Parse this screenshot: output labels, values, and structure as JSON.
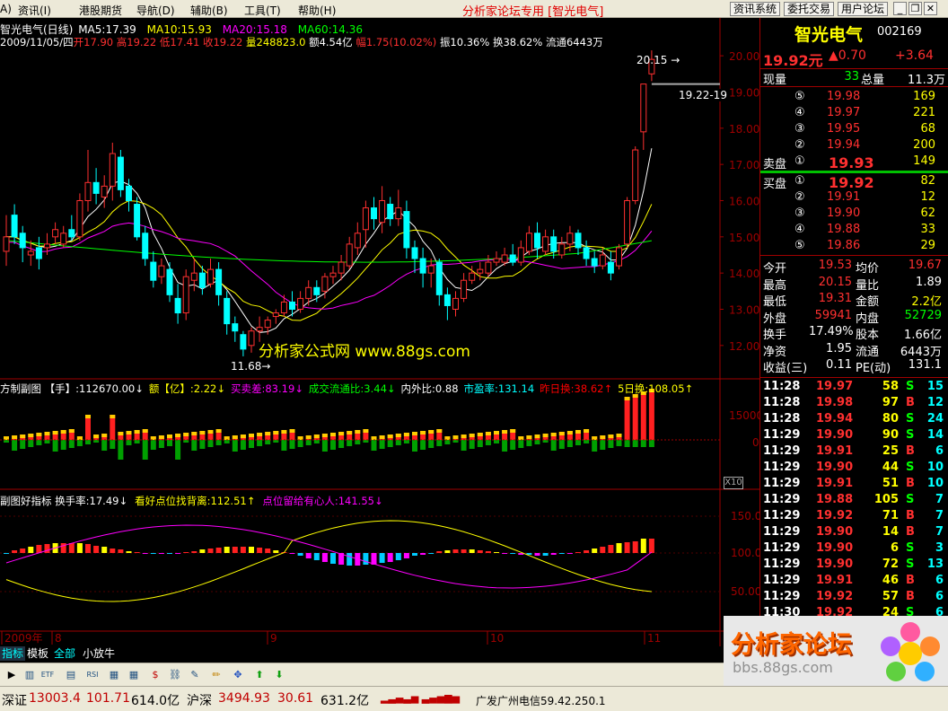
{
  "menubar": {
    "items": [
      "A)",
      "资讯(I)",
      "港股期货",
      "导航(D)",
      "辅助(B)",
      "工具(T)",
      "帮助(H)"
    ],
    "title": "分析家论坛专用 [智光电气]",
    "buttons": [
      "资讯系统",
      "委托交易",
      "用户论坛"
    ]
  },
  "chart_header": {
    "line1_title": "智光电气(日线)",
    "ma5": "MA5:17.39",
    "ma10": "MA10:15.93",
    "ma20": "MA20:15.18",
    "ma60": "MA60:14.36",
    "line2": {
      "date": "2009/11/05/四",
      "open": "开17.90",
      "high": "高19.22",
      "low": "低17.41",
      "close": "收19.22",
      "volume": "量248823.0",
      "amount": "额4.54亿",
      "change": "幅1.75(10.02%)",
      "amplitude": "振10.36%",
      "turnover": "换38.62%",
      "float": "流通6443万"
    }
  },
  "price_axis": [
    "20.00",
    "19.00",
    "18.00",
    "17.00",
    "16.00",
    "15.00",
    "14.00",
    "13.00",
    "12.00"
  ],
  "annotations": {
    "high_label": "20.15",
    "low_label": "11.68",
    "last_price_label": "19.22-19",
    "watermark": "分析家公式网 www.88gs.com"
  },
  "volume_panel": {
    "header": "方制副图 【手】:112670.00↓ 额【亿】:2.22↓ 买卖差:83.19↓ 成交流通比:3.44↓ 内外比:0.88 市盈率:131.14 昨日换:38.62↑ 5日换:108.05↑",
    "parts": [
      {
        "t": "方制副图 【手】:112670.00↓",
        "c": "#ffffff"
      },
      {
        "t": "额【亿】:2.22↓",
        "c": "#ffff00"
      },
      {
        "t": "买卖差:83.19↓",
        "c": "#ff00ff"
      },
      {
        "t": "成交流通比:3.44↓",
        "c": "#00ff00"
      },
      {
        "t": "内外比:0.88",
        "c": "#ffffff"
      },
      {
        "t": "市盈率:131.14",
        "c": "#00ffff"
      },
      {
        "t": "昨日换:38.62↑",
        "c": "#ff0000"
      },
      {
        "t": "5日换:108.05↑",
        "c": "#ffff00"
      }
    ],
    "axis": [
      "15000",
      "0"
    ],
    "scale_label": "X10"
  },
  "indicator_panel": {
    "parts": [
      {
        "t": "副图好指标 换手率:17.49↓",
        "c": "#ffffff"
      },
      {
        "t": "看好点位找背离:112.51↑",
        "c": "#ffff00"
      },
      {
        "t": "点位留给有心人:141.55↓",
        "c": "#ff00ff"
      }
    ],
    "axis": [
      "150.0",
      "100.0",
      "50.00"
    ]
  },
  "date_axis": [
    "2009年",
    "8",
    "9",
    "10",
    "11"
  ],
  "bottom_tabs": [
    "指标",
    "模板",
    "全部",
    "小放牛"
  ],
  "quote": {
    "name": "智光电气",
    "code": "002169",
    "price": "19.92元",
    "change": "▲0.70",
    "change_pct": "+3.64",
    "current_vol_label": "现量",
    "current_vol": "33",
    "total_vol_label": "总量",
    "total_vol": "11.3万",
    "sell_label": "卖盘",
    "buy_label": "买盘",
    "asks": [
      {
        "level": "⑤",
        "price": "19.98",
        "vol": "169"
      },
      {
        "level": "④",
        "price": "19.97",
        "vol": "221"
      },
      {
        "level": "③",
        "price": "19.95",
        "vol": "68"
      },
      {
        "level": "②",
        "price": "19.94",
        "vol": "200"
      },
      {
        "level": "①",
        "price": "19.93",
        "vol": "149"
      }
    ],
    "bids": [
      {
        "level": "①",
        "price": "19.92",
        "vol": "82"
      },
      {
        "level": "②",
        "price": "19.91",
        "vol": "12"
      },
      {
        "level": "③",
        "price": "19.90",
        "vol": "62"
      },
      {
        "level": "④",
        "price": "19.88",
        "vol": "33"
      },
      {
        "level": "⑤",
        "price": "19.86",
        "vol": "29"
      }
    ],
    "stats": [
      {
        "l1": "今开",
        "v1": "19.53",
        "c1": "#ff3030",
        "l2": "均价",
        "v2": "19.67",
        "c2": "#ff3030"
      },
      {
        "l1": "最高",
        "v1": "20.15",
        "c1": "#ff3030",
        "l2": "量比",
        "v2": "1.89",
        "c2": "#ffffff"
      },
      {
        "l1": "最低",
        "v1": "19.31",
        "c1": "#ff3030",
        "l2": "金额",
        "v2": "2.2亿",
        "c2": "#ffff00"
      },
      {
        "l1": "外盘",
        "v1": "59941",
        "c1": "#ff3030",
        "l2": "内盘",
        "v2": "52729",
        "c2": "#00ff00"
      },
      {
        "l1": "换手",
        "v1": "17.49%",
        "c1": "#ffffff",
        "l2": "股本",
        "v2": "1.66亿",
        "c2": "#ffffff"
      },
      {
        "l1": "净资",
        "v1": "1.95",
        "c1": "#ffffff",
        "l2": "流通",
        "v2": "6443万",
        "c2": "#ffffff"
      },
      {
        "l1": "收益(三)",
        "v1": "0.11",
        "c1": "#ffffff",
        "l2": "PE(动)",
        "v2": "131.1",
        "c2": "#ffffff"
      }
    ],
    "ticks": [
      {
        "time": "11:28",
        "price": "19.97",
        "vol": "58",
        "bs": "S",
        "n": "15"
      },
      {
        "time": "11:28",
        "price": "19.98",
        "vol": "97",
        "bs": "B",
        "n": "12"
      },
      {
        "time": "11:28",
        "price": "19.94",
        "vol": "80",
        "bs": "S",
        "n": "24"
      },
      {
        "time": "11:29",
        "price": "19.90",
        "vol": "90",
        "bs": "S",
        "n": "14"
      },
      {
        "time": "11:29",
        "price": "19.91",
        "vol": "25",
        "bs": "B",
        "n": "6"
      },
      {
        "time": "11:29",
        "price": "19.90",
        "vol": "44",
        "bs": "S",
        "n": "10"
      },
      {
        "time": "11:29",
        "price": "19.91",
        "vol": "51",
        "bs": "B",
        "n": "10"
      },
      {
        "time": "11:29",
        "price": "19.88",
        "vol": "105",
        "bs": "S",
        "n": "7"
      },
      {
        "time": "11:29",
        "price": "19.92",
        "vol": "71",
        "bs": "B",
        "n": "7"
      },
      {
        "time": "11:29",
        "price": "19.90",
        "vol": "14",
        "bs": "B",
        "n": "7"
      },
      {
        "time": "11:29",
        "price": "19.90",
        "vol": "6",
        "bs": "S",
        "n": "3"
      },
      {
        "time": "11:29",
        "price": "19.90",
        "vol": "72",
        "bs": "S",
        "n": "13"
      },
      {
        "time": "11:29",
        "price": "19.91",
        "vol": "46",
        "bs": "B",
        "n": "6"
      },
      {
        "time": "11:29",
        "price": "19.92",
        "vol": "57",
        "bs": "B",
        "n": "6"
      },
      {
        "time": "11:30",
        "price": "19.92",
        "vol": "24",
        "bs": "S",
        "n": "6"
      }
    ]
  },
  "status": {
    "sz_label": "深证",
    "sz_index": "13003.4",
    "sz_change": "101.71",
    "sz_amount": "614.0亿",
    "hs_label": "沪深",
    "hs_index": "3494.93",
    "hs_change": "30.61",
    "hs_amount": "631.2亿",
    "server": "广发广州电信59.42.250.1"
  },
  "logo": {
    "text": "分析家论坛",
    "url": "bbs.88gs.com"
  },
  "colors": {
    "up": "#ff3030",
    "down": "#00ffff",
    "ma5": "#ffffff",
    "ma10": "#ffff00",
    "ma20": "#ff00ff",
    "ma60": "#00ff00"
  }
}
